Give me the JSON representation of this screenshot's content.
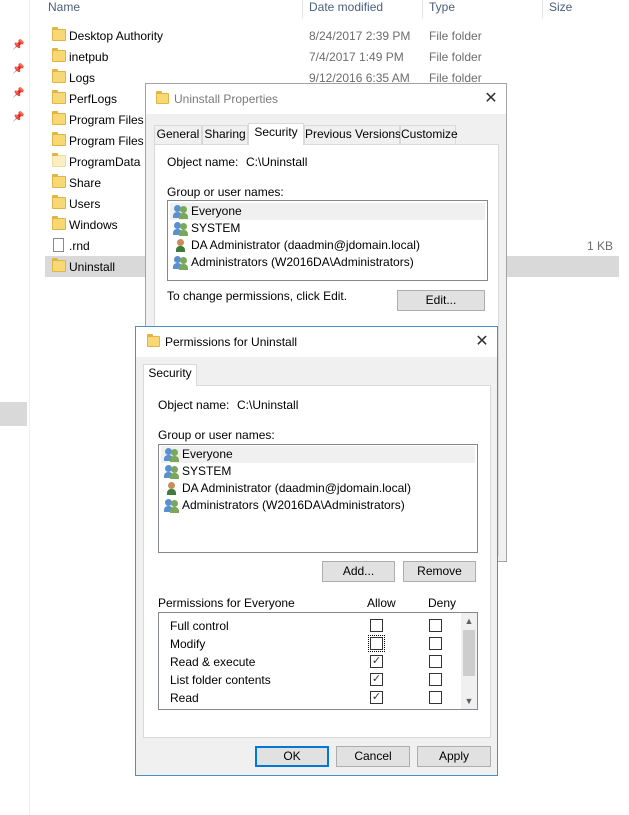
{
  "explorer": {
    "columns": {
      "name": "Name",
      "date": "Date modified",
      "type": "Type",
      "size": "Size"
    },
    "files": [
      {
        "name": "Desktop Authority",
        "date": "8/24/2017 2:39 PM",
        "type": "File folder",
        "size": "",
        "icon": "folder-icon"
      },
      {
        "name": "inetpub",
        "date": "7/4/2017 1:49 PM",
        "type": "File folder",
        "size": "",
        "icon": "folder-icon"
      },
      {
        "name": "Logs",
        "date": "9/12/2016 6:35 AM",
        "type": "File folder",
        "size": "",
        "icon": "folder-icon"
      },
      {
        "name": "PerfLogs",
        "date": "",
        "type": "",
        "size": "",
        "icon": "folder-icon"
      },
      {
        "name": "Program Files",
        "date": "",
        "type": "",
        "size": "",
        "icon": "folder-icon"
      },
      {
        "name": "Program Files",
        "date": "",
        "type": "",
        "size": "",
        "icon": "folder-icon"
      },
      {
        "name": "ProgramData",
        "date": "",
        "type": "",
        "size": "",
        "icon": "folder-icon"
      },
      {
        "name": "Share",
        "date": "",
        "type": "",
        "size": "",
        "icon": "folder-icon"
      },
      {
        "name": "Users",
        "date": "",
        "type": "",
        "size": "",
        "icon": "folder-icon"
      },
      {
        "name": "Windows",
        "date": "",
        "type": "",
        "size": "",
        "icon": "folder-icon"
      },
      {
        "name": ".rnd",
        "date": "",
        "type": "",
        "size": "1 KB",
        "icon": "file-icon"
      },
      {
        "name": "Uninstall",
        "date": "",
        "type": "",
        "size": "",
        "icon": "folder-icon"
      }
    ]
  },
  "properties": {
    "title": "Uninstall Properties",
    "tabs": [
      "General",
      "Sharing",
      "Security",
      "Previous Versions",
      "Customize"
    ],
    "active_tab": "Security",
    "object_label": "Object name:",
    "object_value": "C:\\Uninstall",
    "group_label": "Group or user names:",
    "users": [
      "Everyone",
      "SYSTEM",
      "DA Administrator (daadmin@jdomain.local)",
      "Administrators (W2016DA\\Administrators)"
    ],
    "change_text": "To change permissions, click Edit.",
    "edit_button": "Edit..."
  },
  "permissions": {
    "title": "Permissions for Uninstall",
    "tab": "Security",
    "object_label": "Object name:",
    "object_value": "C:\\Uninstall",
    "group_label": "Group or user names:",
    "users": [
      "Everyone",
      "SYSTEM",
      "DA Administrator (daadmin@jdomain.local)",
      "Administrators (W2016DA\\Administrators)"
    ],
    "add_button": "Add...",
    "remove_button": "Remove",
    "perm_header": "Permissions for Everyone",
    "allow_header": "Allow",
    "deny_header": "Deny",
    "rows": [
      {
        "name": "Full control",
        "allow": false,
        "deny": false
      },
      {
        "name": "Modify",
        "allow": false,
        "deny": false
      },
      {
        "name": "Read & execute",
        "allow": true,
        "deny": false
      },
      {
        "name": "List folder contents",
        "allow": true,
        "deny": false
      },
      {
        "name": "Read",
        "allow": true,
        "deny": false
      }
    ],
    "ok_button": "OK",
    "cancel_button": "Cancel",
    "apply_button": "Apply"
  },
  "colors": {
    "accent": "#0078d7",
    "folder": "#f8d775",
    "selection": "#d9d9d9"
  }
}
